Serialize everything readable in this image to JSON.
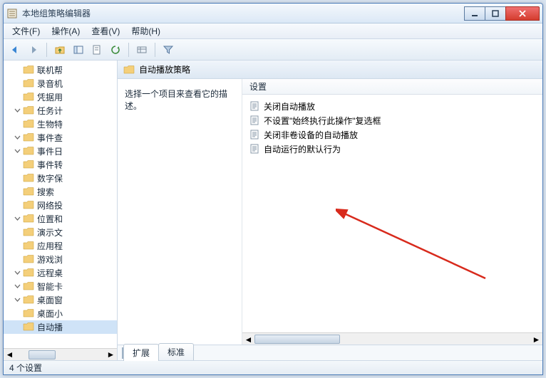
{
  "window": {
    "title": "本地组策略编辑器"
  },
  "menu": [
    "文件(F)",
    "操作(A)",
    "查看(V)",
    "帮助(H)"
  ],
  "content": {
    "header": "自动播放策略",
    "desc": "选择一个项目来查看它的描述。",
    "list_col": "设置",
    "items": [
      "关闭自动播放",
      "不设置\"始终执行此操作\"复选框",
      "关闭非卷设备的自动播放",
      "自动运行的默认行为"
    ]
  },
  "tree": {
    "items": [
      {
        "label": "联机帮",
        "exp": false
      },
      {
        "label": "录音机",
        "exp": false
      },
      {
        "label": "凭据用",
        "exp": false
      },
      {
        "label": "任务计",
        "exp": true
      },
      {
        "label": "生物特",
        "exp": false
      },
      {
        "label": "事件查",
        "exp": true
      },
      {
        "label": "事件日",
        "exp": true
      },
      {
        "label": "事件转",
        "exp": false
      },
      {
        "label": "数字保",
        "exp": false
      },
      {
        "label": "搜索",
        "exp": false
      },
      {
        "label": "网络投",
        "exp": false
      },
      {
        "label": "位置和",
        "exp": true
      },
      {
        "label": "演示文",
        "exp": false
      },
      {
        "label": "应用程",
        "exp": false
      },
      {
        "label": "游戏浏",
        "exp": false
      },
      {
        "label": "远程桌",
        "exp": true
      },
      {
        "label": "智能卡",
        "exp": true
      },
      {
        "label": "桌面窗",
        "exp": true
      },
      {
        "label": "桌面小",
        "exp": false
      },
      {
        "label": "自动播",
        "exp": false,
        "selected": true
      }
    ]
  },
  "tabs": [
    "扩展",
    "标准"
  ],
  "tabs_active": 0,
  "status": "4 个设置"
}
